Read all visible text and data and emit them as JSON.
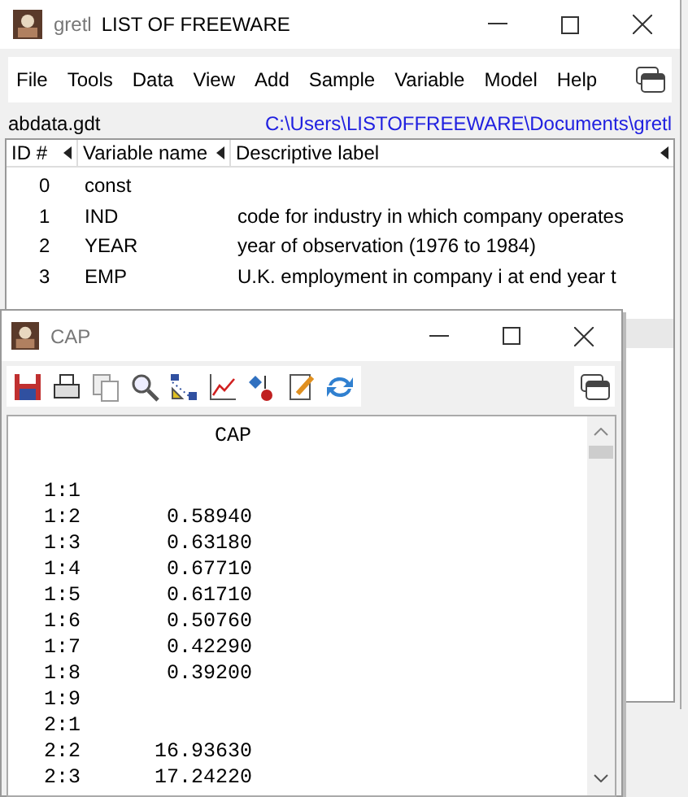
{
  "main_window": {
    "app": "gretl",
    "title": "LIST OF FREEWARE"
  },
  "menu": [
    {
      "label": "File"
    },
    {
      "label": "Tools"
    },
    {
      "label": "Data"
    },
    {
      "label": "View"
    },
    {
      "label": "Add"
    },
    {
      "label": "Sample"
    },
    {
      "label": "Variable"
    },
    {
      "label": "Model"
    },
    {
      "label": "Help"
    }
  ],
  "dataset": {
    "file": "abdata.gdt",
    "path": "C:\\Users\\LISTOFFREEWARE\\Documents\\gretl"
  },
  "table": {
    "columns": [
      "ID #",
      "Variable name",
      "Descriptive label"
    ],
    "rows": [
      {
        "id": "0",
        "name": "const"
      },
      {
        "id": "1",
        "name": "IND",
        "label": "code for industry in which company operates"
      },
      {
        "id": "2",
        "name": "YEAR",
        "label": "year of observation (1976 to 1984)"
      },
      {
        "id": "3",
        "name": "EMP",
        "label": "U.K. employment in company i at end year t"
      }
    ]
  },
  "data_window": {
    "title": "CAP",
    "heading": "CAP",
    "rows": [
      {
        "obs": "1:1"
      },
      {
        "obs": "1:2",
        "value": "0.58940"
      },
      {
        "obs": "1:3",
        "value": "0.63180"
      },
      {
        "obs": "1:4",
        "value": "0.67710"
      },
      {
        "obs": "1:5",
        "value": "0.61710"
      },
      {
        "obs": "1:6",
        "value": "0.50760"
      },
      {
        "obs": "1:7",
        "value": "0.42290"
      },
      {
        "obs": "1:8",
        "value": "0.39200"
      },
      {
        "obs": "1:9"
      },
      {
        "obs": "2:1"
      },
      {
        "obs": "2:2",
        "value": "16.93630"
      },
      {
        "obs": "2:3",
        "value": "17.24220"
      }
    ]
  }
}
